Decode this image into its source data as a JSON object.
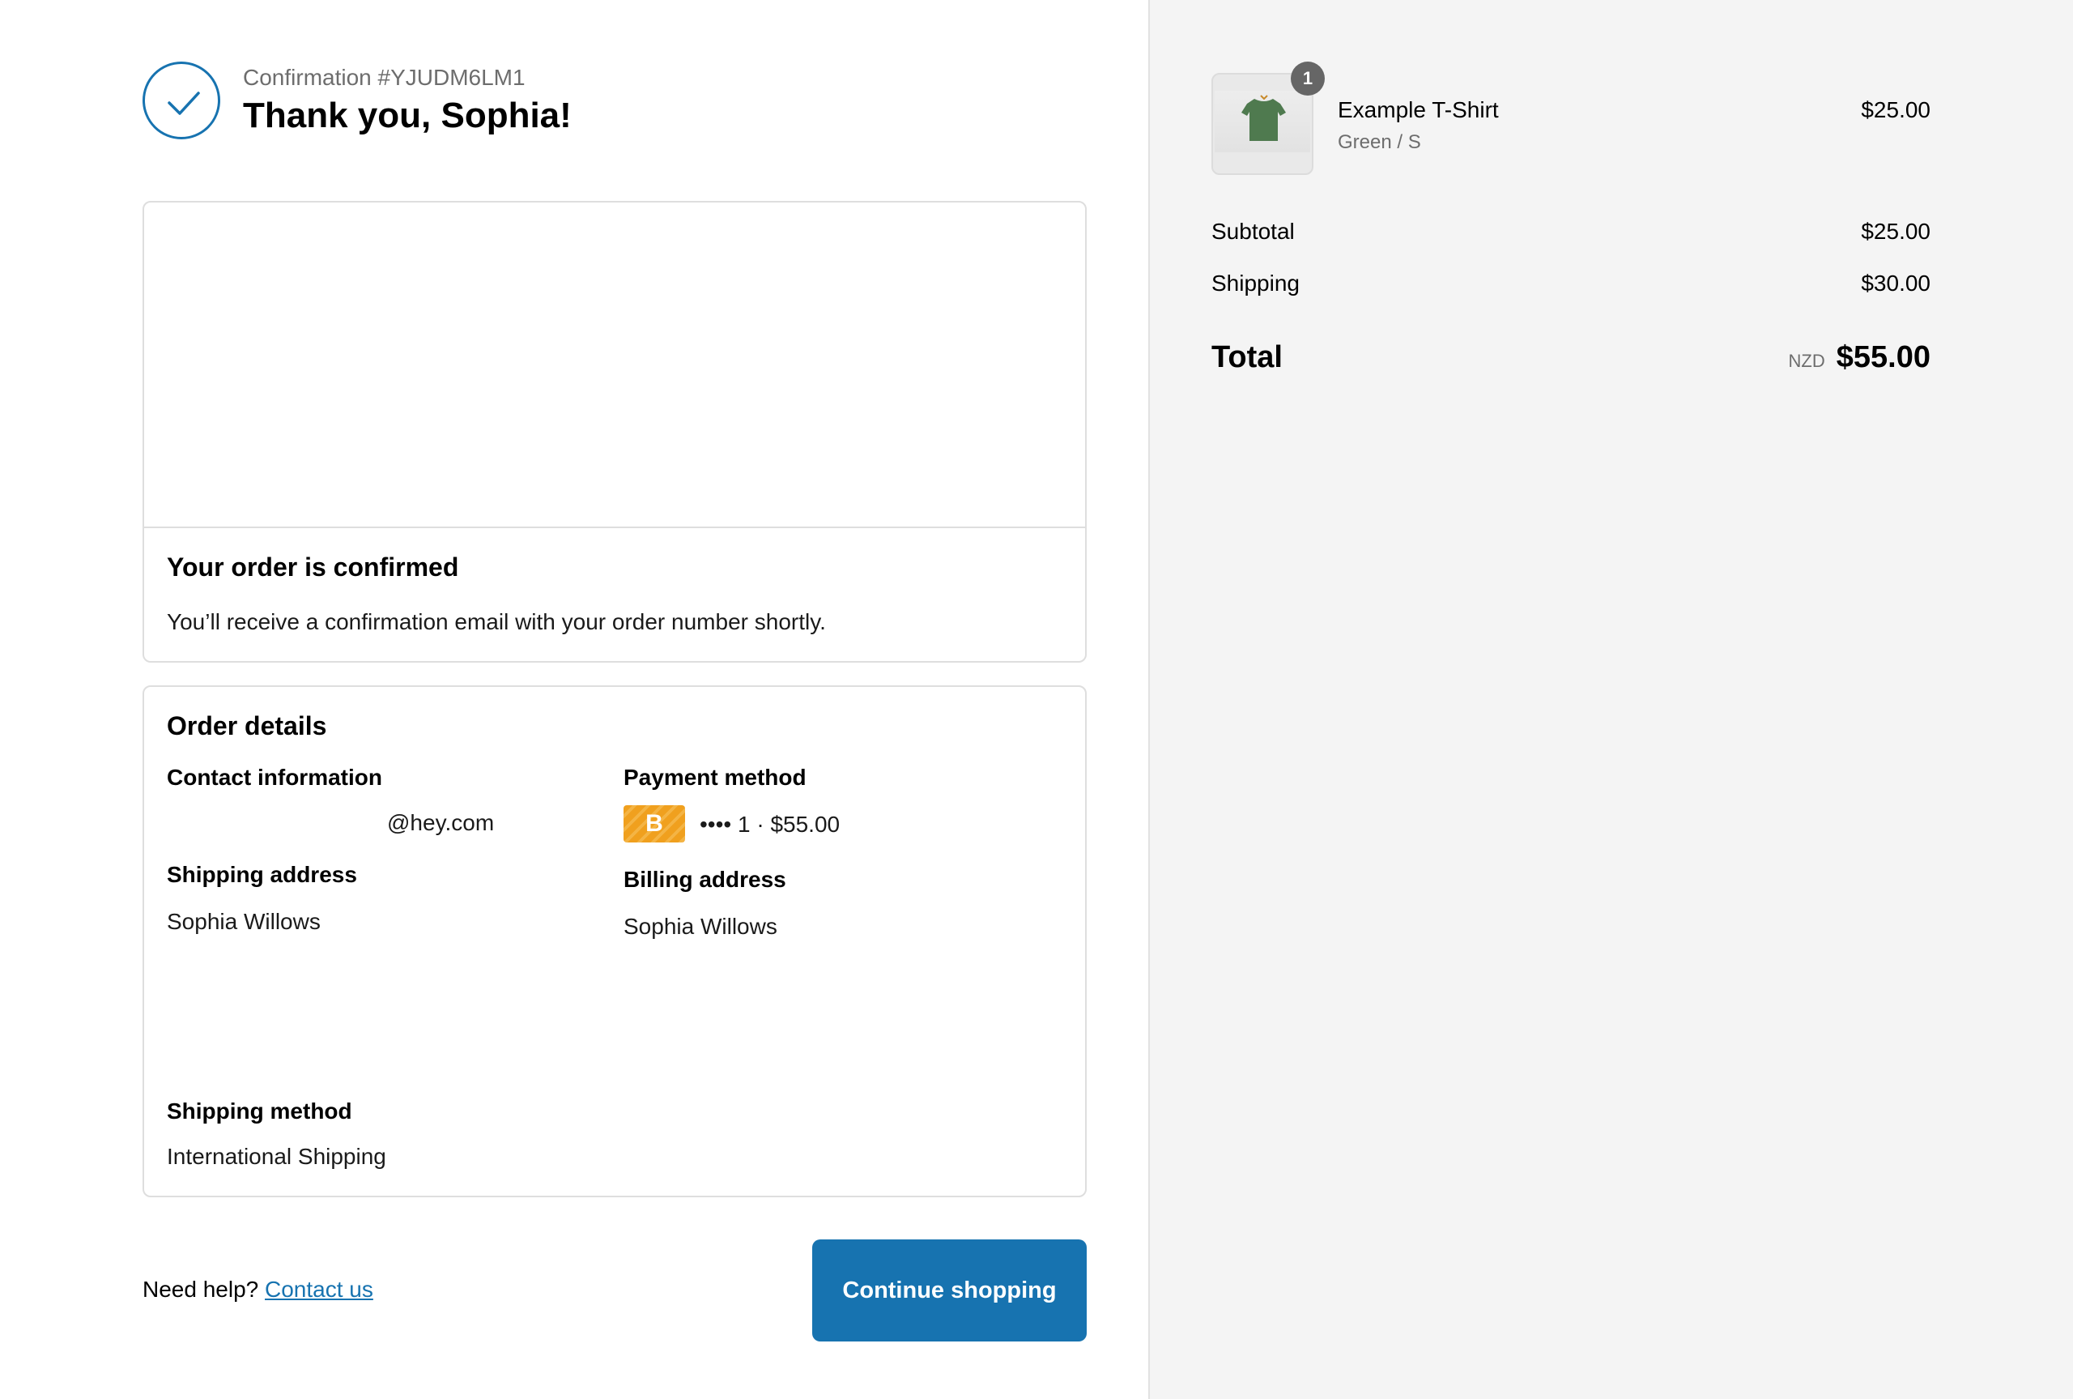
{
  "header": {
    "confirmation_number": "Confirmation #YJUDM6LM1",
    "thank_you": "Thank you, Sophia!"
  },
  "order_status": {
    "title": "Your order is confirmed",
    "message": "You’ll receive a confirmation email with your order number shortly."
  },
  "order_details": {
    "title": "Order details",
    "contact_label": "Contact information",
    "contact_value": "@hey.com",
    "payment_label": "Payment method",
    "payment_badge": "B",
    "payment_value": "•••• 1 · $55.00",
    "shipping_address_label": "Shipping address",
    "shipping_address_name": "Sophia Willows",
    "billing_address_label": "Billing address",
    "billing_address_name": "Sophia Willows",
    "shipping_method_label": "Shipping method",
    "shipping_method_value": "International Shipping"
  },
  "footer": {
    "need_help": "Need help?",
    "contact_link": "Contact us",
    "continue_button": "Continue shopping"
  },
  "summary": {
    "item": {
      "quantity": "1",
      "name": "Example T-Shirt",
      "variant": "Green / S",
      "price": "$25.00"
    },
    "subtotal_label": "Subtotal",
    "subtotal_value": "$25.00",
    "shipping_label": "Shipping",
    "shipping_value": "$30.00",
    "total_label": "Total",
    "currency": "NZD",
    "total_value": "$55.00"
  },
  "colors": {
    "accent": "#1773b0",
    "summary_background": "#f4f4f4",
    "payment_badge": "#f0a01e",
    "tshirt": "#4f7a4f"
  },
  "icons": [
    "checkmark-circle-icon",
    "tshirt-image"
  ]
}
